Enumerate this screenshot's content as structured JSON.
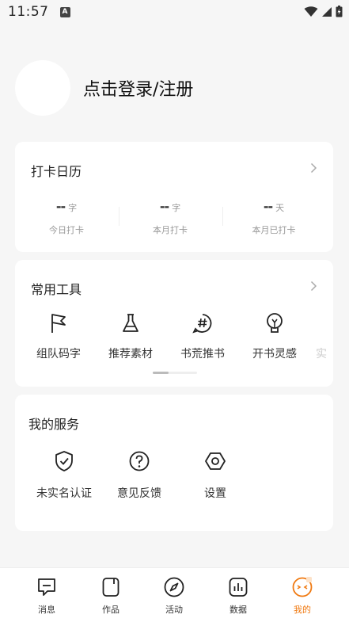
{
  "status": {
    "time": "11:57",
    "a_badge": "A"
  },
  "profile": {
    "login_text": "点击登录/注册"
  },
  "checkin": {
    "title": "打卡日历",
    "stats": [
      {
        "value": "--",
        "unit": "字",
        "label": "今日打卡"
      },
      {
        "value": "--",
        "unit": "字",
        "label": "本月打卡"
      },
      {
        "value": "--",
        "unit": "天",
        "label": "本月已打卡"
      }
    ]
  },
  "tools": {
    "title": "常用工具",
    "items": [
      {
        "label": "组队码字",
        "icon": "flag-icon"
      },
      {
        "label": "推荐素材",
        "icon": "flask-icon"
      },
      {
        "label": "书荒推书",
        "icon": "hashtag-bubble-icon"
      },
      {
        "label": "开书灵感",
        "icon": "lightbulb-icon"
      },
      {
        "label": "实",
        "icon": "partial-tool-icon"
      }
    ]
  },
  "services": {
    "title": "我的服务",
    "items": [
      {
        "label": "未实名认证",
        "icon": "shield-check-icon"
      },
      {
        "label": "意见反馈",
        "icon": "help-circle-icon"
      },
      {
        "label": "设置",
        "icon": "settings-hexagon-icon"
      }
    ]
  },
  "nav": {
    "items": [
      {
        "label": "消息",
        "icon": "message-icon"
      },
      {
        "label": "作品",
        "icon": "works-icon"
      },
      {
        "label": "活动",
        "icon": "compass-icon"
      },
      {
        "label": "数据",
        "icon": "chart-icon"
      },
      {
        "label": "我的",
        "icon": "profile-face-icon",
        "active": true
      }
    ]
  },
  "colors": {
    "accent": "#f07a12",
    "background": "#f6f6f6",
    "card": "#ffffff"
  }
}
